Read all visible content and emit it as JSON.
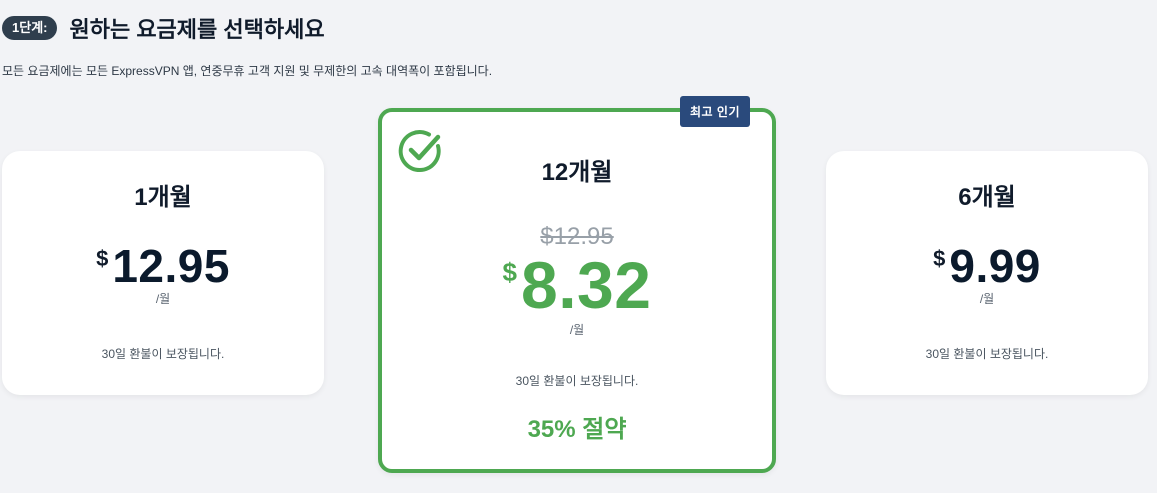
{
  "header": {
    "step_label": "1단계:",
    "title": "원하는 요금제를 선택하세요",
    "subtitle": "모든 요금제에는 모든 ExpressVPN 앱, 연중무휴 고객 지원 및 무제한의 고속 대역폭이 포함됩니다."
  },
  "plans": {
    "one_month": {
      "name": "1개월",
      "currency": "$",
      "price": "12.95",
      "per": "/월",
      "guarantee": "30일 환불이 보장됩니다."
    },
    "twelve_month": {
      "badge": "최고 인기",
      "name": "12개월",
      "old_price": "$12.95",
      "currency": "$",
      "price": "8.32",
      "per": "/월",
      "guarantee": "30일 환불이 보장됩니다.",
      "savings": "35% 절약",
      "selected_icon": "check-circle-icon"
    },
    "six_month": {
      "name": "6개월",
      "currency": "$",
      "price": "9.99",
      "per": "/월",
      "guarantee": "30일 환불이 보장됩니다."
    }
  },
  "colors": {
    "accent_green": "#4ea851",
    "badge_blue": "#2a4a7c",
    "step_badge": "#2f3e4d",
    "text_dark": "#101b2b"
  }
}
